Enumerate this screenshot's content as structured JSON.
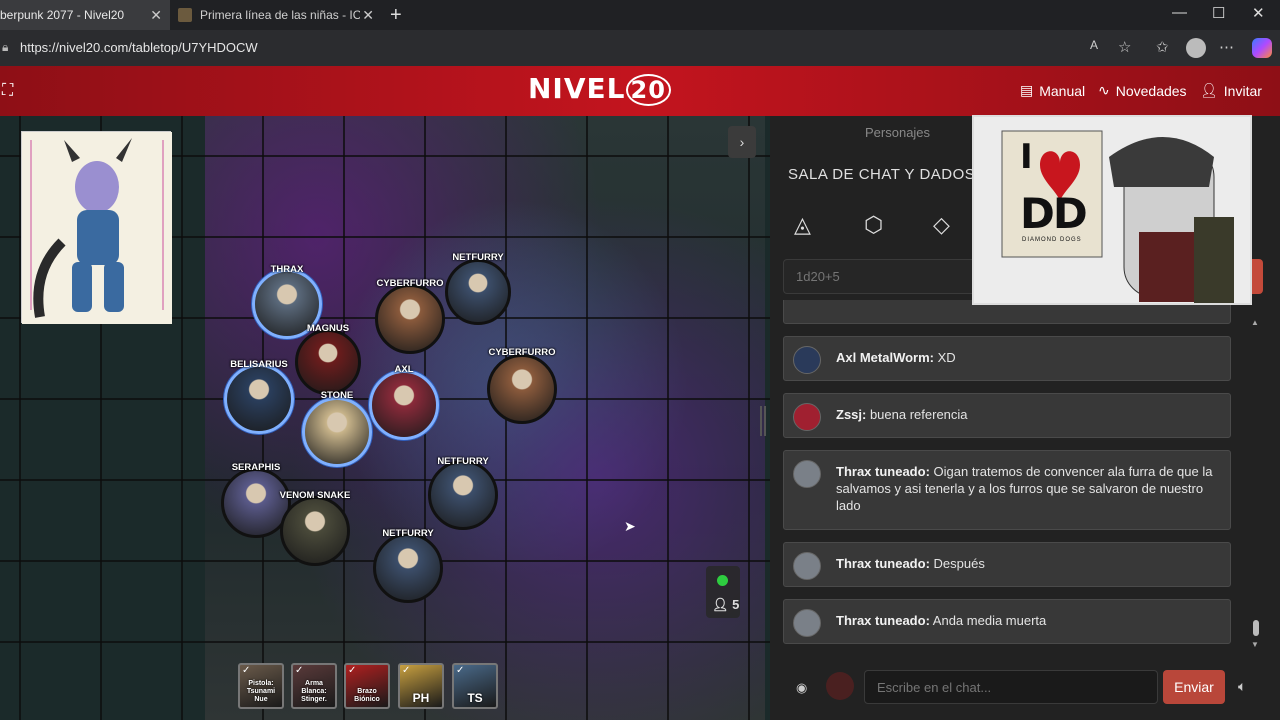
{
  "browser": {
    "tabs": [
      {
        "title": "berpunk 2077 - Nivel20"
      },
      {
        "title": "Primera línea de las niñas - IOP W"
      }
    ],
    "new_tab": "+",
    "win_controls": [
      "—",
      "☐",
      "✕"
    ],
    "url": "https://nivel20.com/tabletop/U7YHDOCW"
  },
  "header": {
    "logo_text": "NIVEL",
    "logo_num": "20",
    "nav": [
      {
        "label": "Manual",
        "icon": "book-icon"
      },
      {
        "label": "Novedades",
        "icon": "pulse-icon"
      },
      {
        "label": "Invitar",
        "icon": "add-user-icon"
      }
    ]
  },
  "map": {
    "tokens": [
      {
        "name": "THRAX",
        "color": "#5b6a7c"
      },
      {
        "name": "MAGNUS",
        "color": "#6b1c1c"
      },
      {
        "name": "CYBERFURRO",
        "color": "#8a5a3c"
      },
      {
        "name": "NETFURRY",
        "color": "#3c4e6a"
      },
      {
        "name": "BELISARIUS",
        "color": "#2a3e5c"
      },
      {
        "name": "STONE",
        "color": "#c8b48a"
      },
      {
        "name": "AXL",
        "color": "#8a2a3a"
      },
      {
        "name": "CYBERFURRO",
        "color": "#8a5a3c"
      },
      {
        "name": "SERAPHIS",
        "color": "#5a5a8a"
      },
      {
        "name": "VENOM SNAKE",
        "color": "#4a4a3a"
      },
      {
        "name": "NETFURRY",
        "color": "#3c4e6a"
      },
      {
        "name": "NETFURRY",
        "color": "#3c4e6a"
      }
    ],
    "online_players": "5",
    "hotbar": [
      {
        "label": "Pistola: Tsunami Nue",
        "color": "#6a5a4a"
      },
      {
        "label": "Arma Blanca: Stinger.",
        "color": "#5a3a3a"
      },
      {
        "label": "Brazo Biónico",
        "color": "#b02020"
      },
      {
        "label": "PH",
        "color": "#c8a040"
      },
      {
        "label": "TS",
        "color": "#4a6a8a"
      }
    ]
  },
  "chat": {
    "tab_personajes": "Personajes",
    "title": "SALA DE CHAT Y DADOS",
    "dice_input_placeholder": "1d20+5",
    "messages": [
      {
        "author": "Axl MetalWorm:",
        "text": " XD",
        "avatar_color": "#2a3a5a"
      },
      {
        "author": "Zssj:",
        "text": " buena referencia",
        "avatar_color": "#a02030"
      },
      {
        "author": "Thrax tuneado:",
        "text": " Oigan tratemos de convencer ala furra de que la salvamos y asi tenerla y a los furros que se salvaron de nuestro lado",
        "avatar_color": "#7a8088"
      },
      {
        "author": "Thrax tuneado:",
        "text": " Después",
        "avatar_color": "#7a8088"
      },
      {
        "author": "Thrax tuneado:",
        "text": " Anda media muerta",
        "avatar_color": "#7a8088"
      }
    ],
    "input_placeholder": "Escribe en el chat...",
    "send_label": "Enviar"
  },
  "webcam": {
    "sign_line1": "I",
    "sign_line2": "DD",
    "sign_caption": "DIAMOND DOGS"
  }
}
